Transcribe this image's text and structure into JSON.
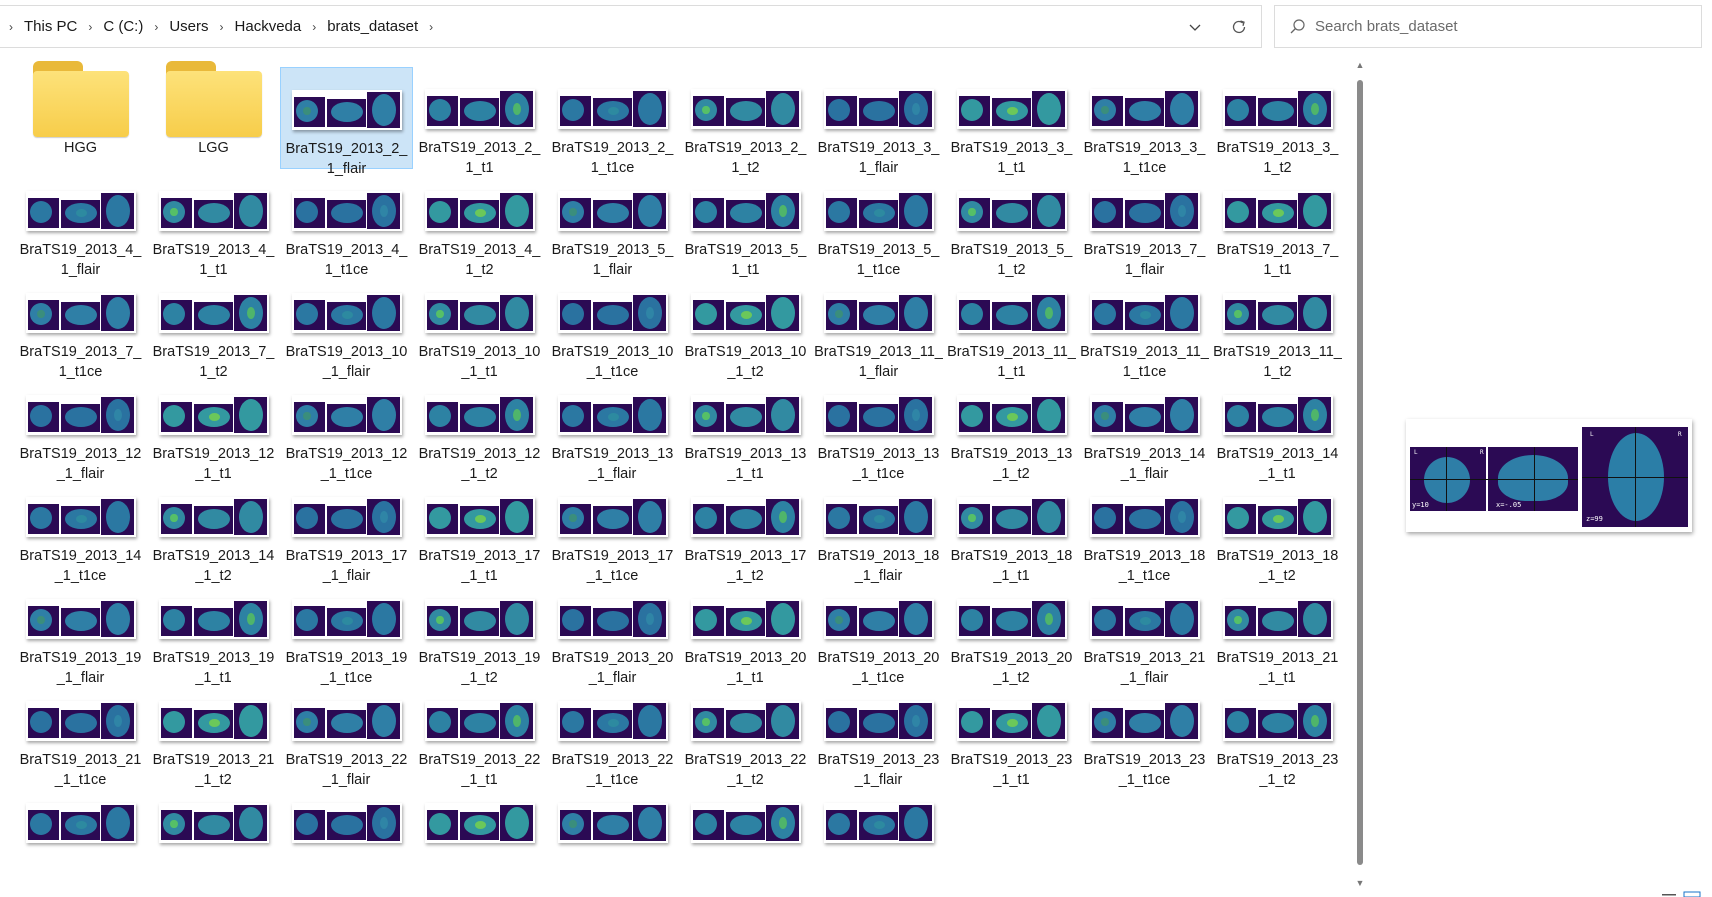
{
  "breadcrumbs": [
    "This PC",
    "C (C:)",
    "Users",
    "Hackveda",
    "brats_dataset"
  ],
  "search": {
    "placeholder": "Search brats_dataset"
  },
  "folders": [
    {
      "name": "HGG"
    },
    {
      "name": "LGG"
    }
  ],
  "files": [
    {
      "label": "BraTS19_2013_2_1_flair",
      "selected": true
    },
    {
      "label": "BraTS19_2013_2_1_t1"
    },
    {
      "label": "BraTS19_2013_2_1_t1ce"
    },
    {
      "label": "BraTS19_2013_2_1_t2"
    },
    {
      "label": "BraTS19_2013_3_1_flair"
    },
    {
      "label": "BraTS19_2013_3_1_t1"
    },
    {
      "label": "BraTS19_2013_3_1_t1ce"
    },
    {
      "label": "BraTS19_2013_3_1_t2"
    },
    {
      "label": "BraTS19_2013_4_1_flair"
    },
    {
      "label": "BraTS19_2013_4_1_t1"
    },
    {
      "label": "BraTS19_2013_4_1_t1ce"
    },
    {
      "label": "BraTS19_2013_4_1_t2"
    },
    {
      "label": "BraTS19_2013_5_1_flair"
    },
    {
      "label": "BraTS19_2013_5_1_t1"
    },
    {
      "label": "BraTS19_2013_5_1_t1ce"
    },
    {
      "label": "BraTS19_2013_5_1_t2"
    },
    {
      "label": "BraTS19_2013_7_1_flair"
    },
    {
      "label": "BraTS19_2013_7_1_t1"
    },
    {
      "label": "BraTS19_2013_7_1_t1ce"
    },
    {
      "label": "BraTS19_2013_7_1_t2"
    },
    {
      "label": "BraTS19_2013_10_1_flair"
    },
    {
      "label": "BraTS19_2013_10_1_t1"
    },
    {
      "label": "BraTS19_2013_10_1_t1ce"
    },
    {
      "label": "BraTS19_2013_10_1_t2"
    },
    {
      "label": "BraTS19_2013_11_1_flair"
    },
    {
      "label": "BraTS19_2013_11_1_t1"
    },
    {
      "label": "BraTS19_2013_11_1_t1ce"
    },
    {
      "label": "BraTS19_2013_11_1_t2"
    },
    {
      "label": "BraTS19_2013_12_1_flair"
    },
    {
      "label": "BraTS19_2013_12_1_t1"
    },
    {
      "label": "BraTS19_2013_12_1_t1ce"
    },
    {
      "label": "BraTS19_2013_12_1_t2"
    },
    {
      "label": "BraTS19_2013_13_1_flair"
    },
    {
      "label": "BraTS19_2013_13_1_t1"
    },
    {
      "label": "BraTS19_2013_13_1_t1ce"
    },
    {
      "label": "BraTS19_2013_13_1_t2"
    },
    {
      "label": "BraTS19_2013_14_1_flair"
    },
    {
      "label": "BraTS19_2013_14_1_t1"
    },
    {
      "label": "BraTS19_2013_14_1_t1ce"
    },
    {
      "label": "BraTS19_2013_14_1_t2"
    },
    {
      "label": "BraTS19_2013_17_1_flair"
    },
    {
      "label": "BraTS19_2013_17_1_t1"
    },
    {
      "label": "BraTS19_2013_17_1_t1ce"
    },
    {
      "label": "BraTS19_2013_17_1_t2"
    },
    {
      "label": "BraTS19_2013_18_1_flair"
    },
    {
      "label": "BraTS19_2013_18_1_t1"
    },
    {
      "label": "BraTS19_2013_18_1_t1ce"
    },
    {
      "label": "BraTS19_2013_18_1_t2"
    },
    {
      "label": "BraTS19_2013_19_1_flair"
    },
    {
      "label": "BraTS19_2013_19_1_t1"
    },
    {
      "label": "BraTS19_2013_19_1_t1ce"
    },
    {
      "label": "BraTS19_2013_19_1_t2"
    },
    {
      "label": "BraTS19_2013_20_1_flair"
    },
    {
      "label": "BraTS19_2013_20_1_t1"
    },
    {
      "label": "BraTS19_2013_20_1_t1ce"
    },
    {
      "label": "BraTS19_2013_20_1_t2"
    },
    {
      "label": "BraTS19_2013_21_1_flair"
    },
    {
      "label": "BraTS19_2013_21_1_t1"
    },
    {
      "label": "BraTS19_2013_21_1_t1ce"
    },
    {
      "label": "BraTS19_2013_21_1_t2"
    },
    {
      "label": "BraTS19_2013_22_1_flair"
    },
    {
      "label": "BraTS19_2013_22_1_t1"
    },
    {
      "label": "BraTS19_2013_22_1_t1ce"
    },
    {
      "label": "BraTS19_2013_22_1_t2"
    },
    {
      "label": "BraTS19_2013_23_1_flair"
    },
    {
      "label": "BraTS19_2013_23_1_t1"
    },
    {
      "label": "BraTS19_2013_23_1_t1ce"
    },
    {
      "label": "BraTS19_2013_23_1_t2"
    },
    {
      "label": ""
    },
    {
      "label": ""
    },
    {
      "label": ""
    },
    {
      "label": ""
    },
    {
      "label": ""
    },
    {
      "label": ""
    },
    {
      "label": ""
    }
  ],
  "preview": {
    "left_tag": "L",
    "right_tag": "R",
    "left_tag_2": "L",
    "right_tag_2": "R",
    "coord_y": "y=10",
    "coord_x": "x=-.05",
    "coord_z": "z=99"
  },
  "icons": {
    "dropdown": "chevron-down-icon",
    "refresh": "refresh-icon",
    "search": "search-icon",
    "folder": "folder-icon"
  },
  "colors": {
    "selection": "#cce4f7",
    "folder": "#f7cd4a",
    "thumb_bg": "#2b0a54"
  }
}
